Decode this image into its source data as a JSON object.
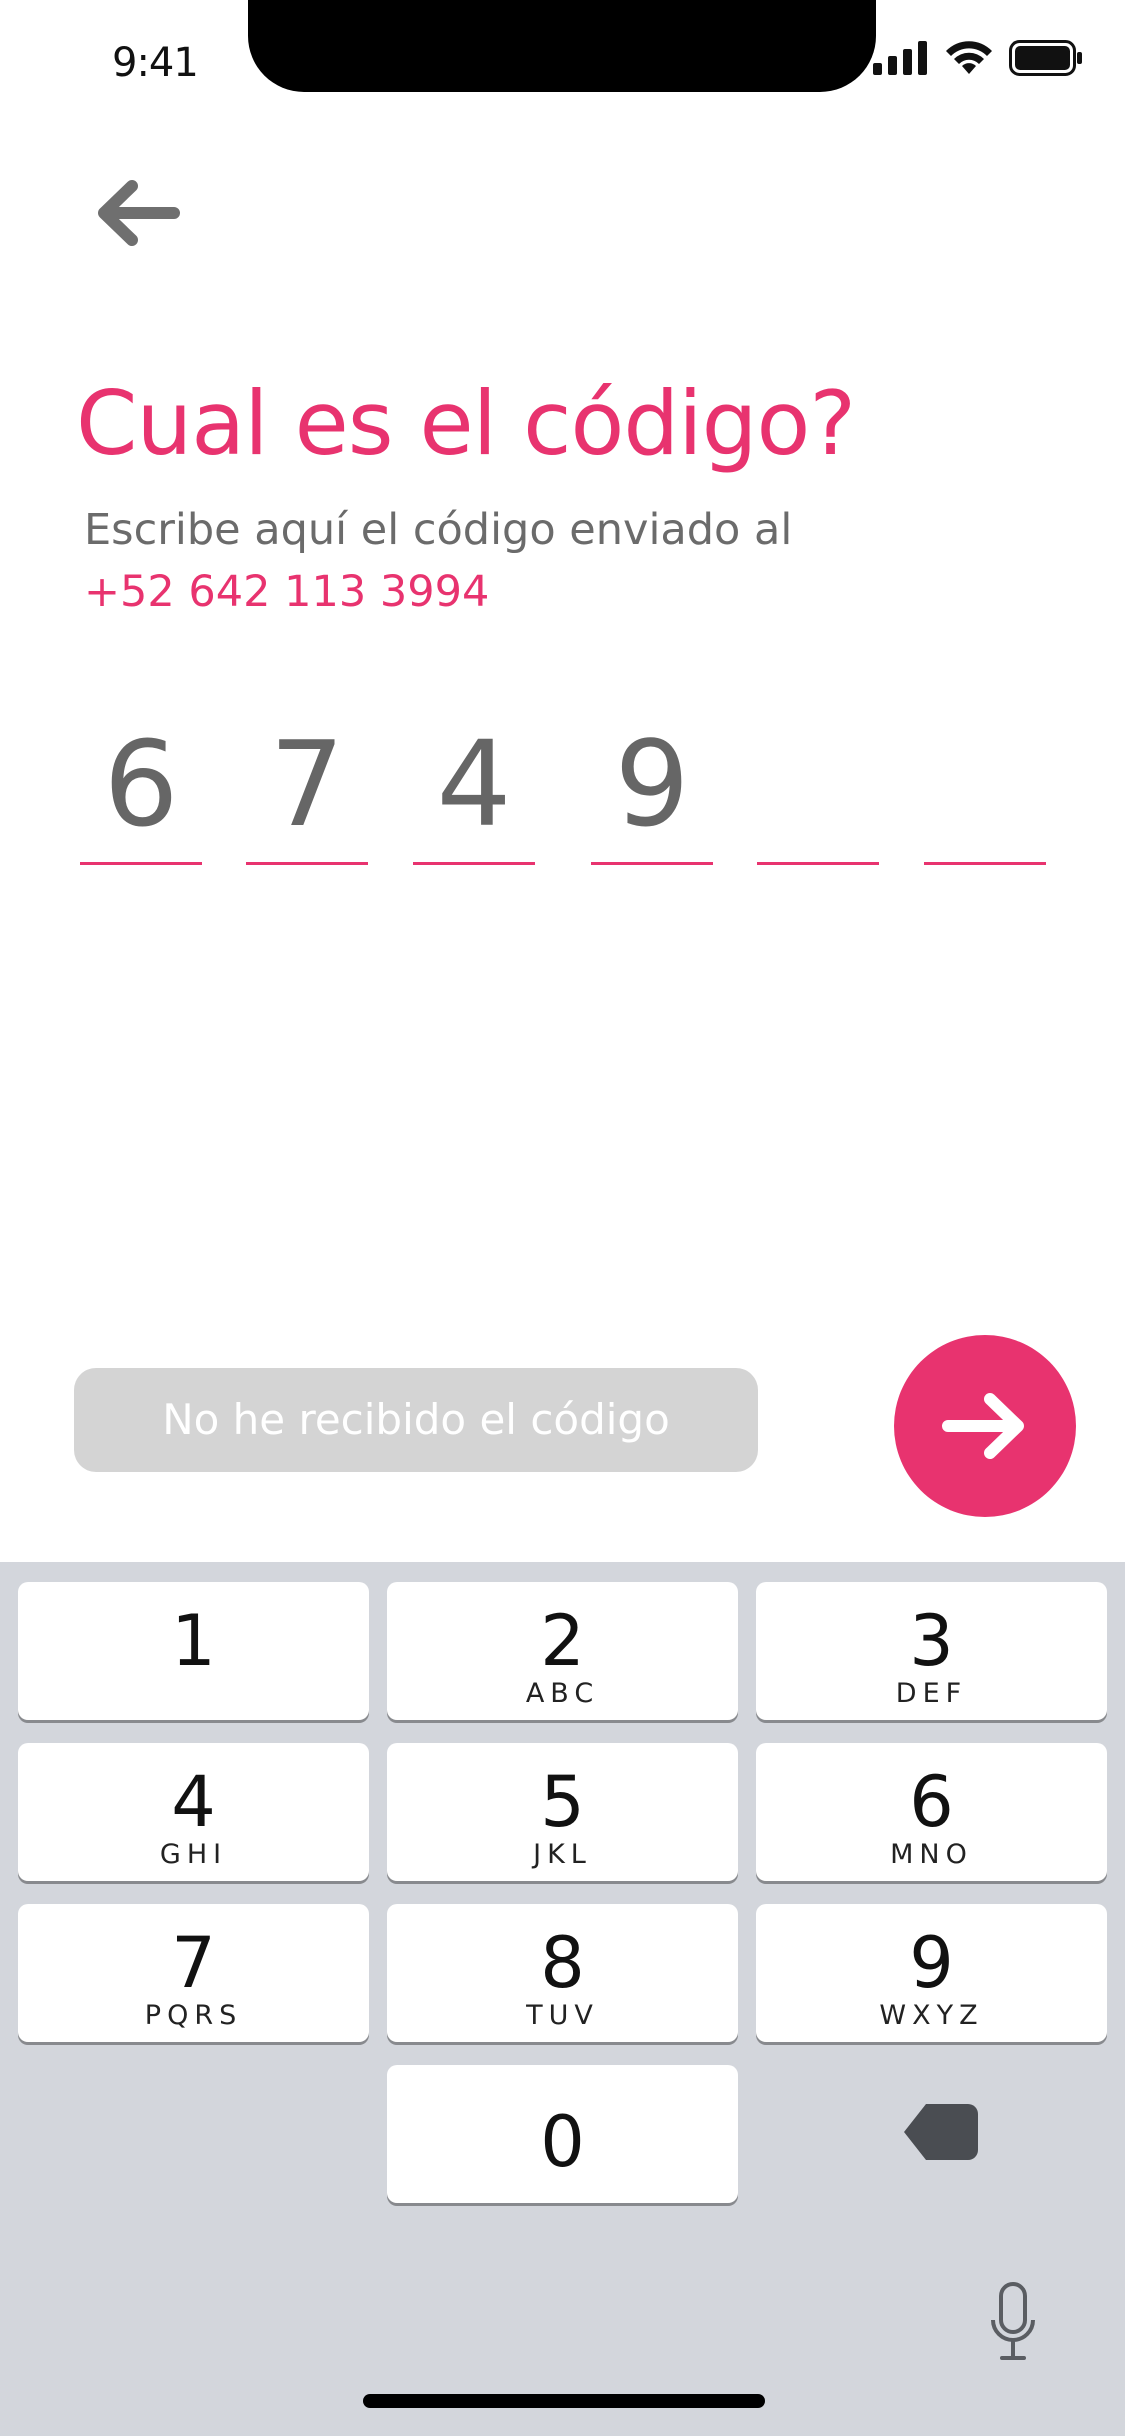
{
  "status_bar": {
    "time": "9:41"
  },
  "header": {
    "back_icon": "arrow-left-icon"
  },
  "content": {
    "title": "Cual es el código?",
    "subtitle": "Escribe aquí el código enviado al",
    "phone": "+52 642 113 3994",
    "code_digits": [
      "6",
      "7",
      "4",
      "9",
      "",
      ""
    ]
  },
  "actions": {
    "resend_label": "No he recibido el código",
    "next_icon": "arrow-right-icon"
  },
  "keypad": {
    "keys": [
      {
        "digit": "1",
        "letters": ""
      },
      {
        "digit": "2",
        "letters": "ABC"
      },
      {
        "digit": "3",
        "letters": "DEF"
      },
      {
        "digit": "4",
        "letters": "GHI"
      },
      {
        "digit": "5",
        "letters": "JKL"
      },
      {
        "digit": "6",
        "letters": "MNO"
      },
      {
        "digit": "7",
        "letters": "PQRS"
      },
      {
        "digit": "8",
        "letters": "TUV"
      },
      {
        "digit": "9",
        "letters": "WXYZ"
      },
      {
        "digit": "0",
        "letters": ""
      }
    ],
    "delete_icon": "backspace-icon",
    "mic_icon": "microphone-icon"
  },
  "colors": {
    "accent": "#e8336f",
    "secondary_text": "#6b6b6b",
    "disabled_button": "#d4d4d4",
    "keyboard_bg": "#d3d6dc"
  }
}
